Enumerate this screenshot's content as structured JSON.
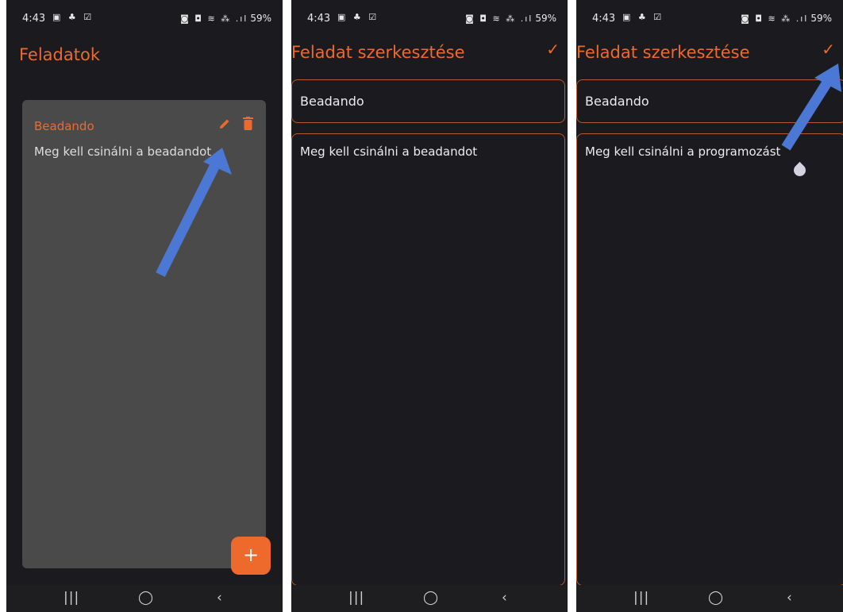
{
  "status_bar": {
    "time": "4:43",
    "left_icons": "▣ ♣ ☑",
    "right_icons": "◙ ◘ ≋ ⁂ .ıl",
    "battery": "59%"
  },
  "screen1": {
    "title": "Feladatok",
    "card": {
      "title": "Beadando",
      "body": "Meg kell csinálni a beadandot"
    },
    "fab_label": "+"
  },
  "screen2": {
    "title": "Feladat szerkesztése",
    "confirm_icon": "✓",
    "title_field": "Beadando",
    "body_field": "Meg kell csinálni a beadandot"
  },
  "screen3": {
    "title": "Feladat szerkesztése",
    "confirm_icon": "✓",
    "title_field": "Beadando",
    "body_field": "Meg kell csinálni a programozást"
  },
  "nav": {
    "recent": "|||",
    "home": "◯",
    "back": "‹"
  },
  "colors": {
    "accent": "#ee6a2c",
    "background": "#1b1a1e",
    "card": "#4a4a4a",
    "annotation_arrow": "#4a78d4"
  }
}
